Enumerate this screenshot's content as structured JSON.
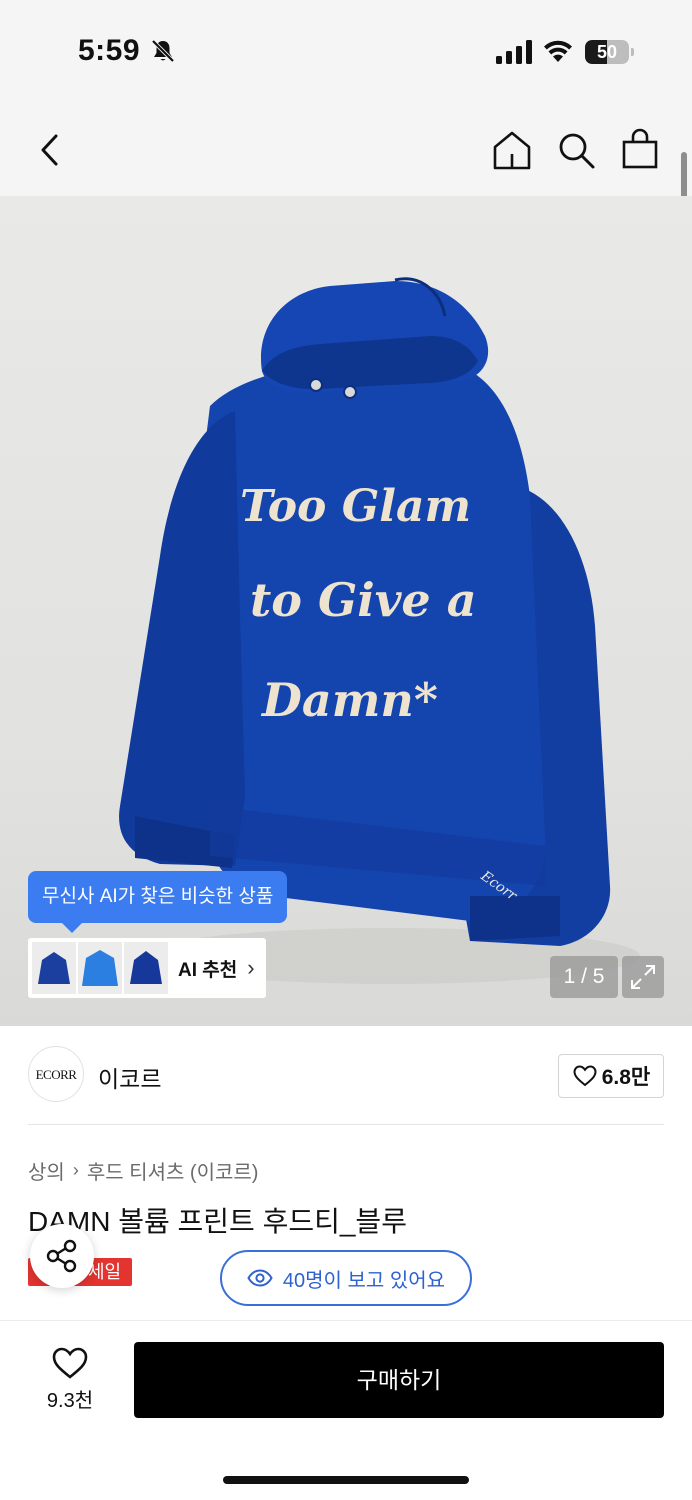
{
  "status_bar": {
    "time": "5:59",
    "battery": "50",
    "battery_level": 0.5
  },
  "nav": {
    "icons": [
      "back-icon",
      "home-icon",
      "search-icon",
      "shopping-bag-icon"
    ]
  },
  "product_image": {
    "print_text": [
      "Too Glam",
      "to Give a",
      "Damn*"
    ],
    "sleeve_text": "Ecorr",
    "page_indicator": "1 / 5",
    "ai_tooltip": "무신사 AI가 찾은 비슷한 상품",
    "ai_recommend_label": "AI 추천",
    "colors": {
      "hoodie": "#1140a6",
      "print": "#ede3cf",
      "tooltip": "#3b7cf0"
    }
  },
  "brand": {
    "logo_text": "ECORR",
    "name": "이코르",
    "likes": "6.8만"
  },
  "breadcrumb": [
    "상의",
    "후드 티셔츠 (이코르)"
  ],
  "product": {
    "title": "DAMN 볼륨 프린트 후드티_블루",
    "sale_badge": "세일"
  },
  "viewers": "40명이 보고 있어요",
  "bottom_bar": {
    "wish_count": "9.3천",
    "buy_label": "구매하기"
  }
}
